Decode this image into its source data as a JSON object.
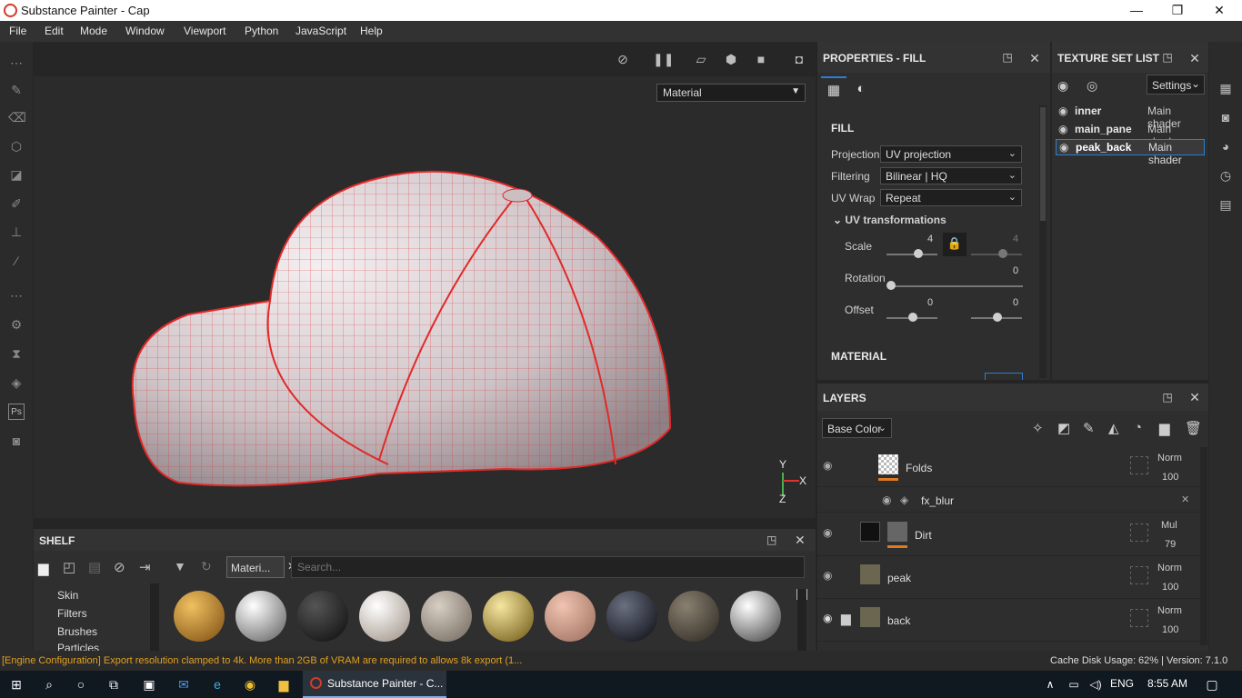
{
  "window": {
    "title": "Substance Painter - Cap",
    "minimize": "—",
    "maximize": "❐",
    "close": "✕"
  },
  "menu": [
    "File",
    "Edit",
    "Mode",
    "Window",
    "Viewport",
    "Python",
    "JavaScript",
    "Help"
  ],
  "viewport": {
    "material_mode": "Material",
    "axis": {
      "y": "Y",
      "x": "X",
      "z": "Z"
    }
  },
  "properties": {
    "title": "PROPERTIES - FILL",
    "section": "FILL",
    "projection": {
      "label": "Projection",
      "value": "UV projection"
    },
    "filtering": {
      "label": "Filtering",
      "value": "Bilinear | HQ"
    },
    "uvwrap": {
      "label": "UV Wrap",
      "value": "Repeat"
    },
    "uvtrans": "UV transformations",
    "scale": {
      "label": "Scale",
      "v1": "4",
      "v2": "4"
    },
    "rotation": {
      "label": "Rotation",
      "v": "0"
    },
    "offset": {
      "label": "Offset",
      "v1": "0",
      "v2": "0"
    },
    "material": "MATERIAL"
  },
  "texture_set": {
    "title": "TEXTURE SET LIST",
    "settings": "Settings",
    "items": [
      {
        "name": "inner",
        "shader": "Main shader"
      },
      {
        "name": "main_pane",
        "shader": "Main shader"
      },
      {
        "name": "peak_back",
        "shader": "Main shader"
      }
    ]
  },
  "layers": {
    "title": "LAYERS",
    "channel": "Base Color",
    "rows": [
      {
        "name": "Folds",
        "blend": "Norm",
        "opacity": "100"
      },
      {
        "name": "fx_blur"
      },
      {
        "name": "Dirt",
        "blend": "Mul",
        "opacity": "79"
      },
      {
        "name": "peak",
        "blend": "Norm",
        "opacity": "100"
      },
      {
        "name": "back",
        "blend": "Norm",
        "opacity": "100"
      }
    ]
  },
  "shelf": {
    "title": "SHELF",
    "tab": "Materi...",
    "search_placeholder": "Search...",
    "categories": [
      "Skin",
      "Filters",
      "Brushes",
      "Particles"
    ]
  },
  "status": {
    "message": "[Engine Configuration] Export resolution clamped to 4k. More than 2GB of VRAM are required to allows 8k export (1...",
    "cache": "Cache Disk Usage:",
    "cache_value": "62% | Version: 7.1.0"
  },
  "taskbar": {
    "app": "Substance Painter - C...",
    "lang": "ENG",
    "time": "8:55 AM"
  },
  "colors": {
    "accent": "#2a7fd4",
    "warning": "#e0a020",
    "wire": "#e02a2a"
  }
}
